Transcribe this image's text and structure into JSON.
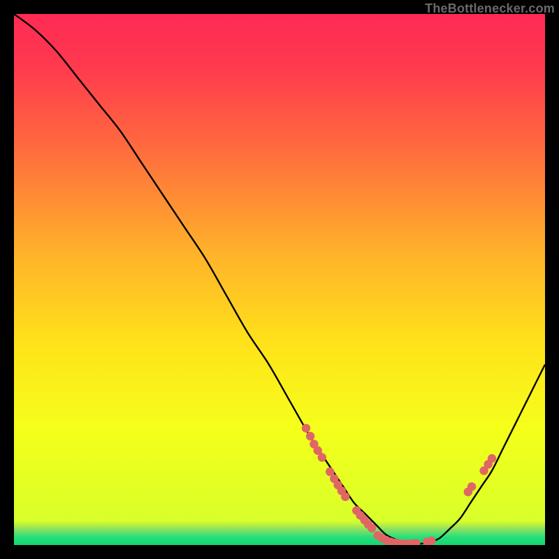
{
  "watermark": "TheBottlenecker.com",
  "chart_data": {
    "type": "line",
    "title": "",
    "xlabel": "",
    "ylabel": "",
    "xlim": [
      0,
      100
    ],
    "ylim": [
      0,
      100
    ],
    "background_gradient": {
      "stops": [
        {
          "offset": 0.0,
          "color": "#ff2a55"
        },
        {
          "offset": 0.1,
          "color": "#ff3a4e"
        },
        {
          "offset": 0.25,
          "color": "#ff6a3e"
        },
        {
          "offset": 0.45,
          "color": "#ffb22a"
        },
        {
          "offset": 0.62,
          "color": "#ffe21a"
        },
        {
          "offset": 0.78,
          "color": "#f5ff1a"
        },
        {
          "offset": 0.955,
          "color": "#d8ff2a"
        },
        {
          "offset": 0.97,
          "color": "#8de05f"
        },
        {
          "offset": 0.985,
          "color": "#27e07a"
        },
        {
          "offset": 1.0,
          "color": "#12d66e"
        }
      ]
    },
    "series": [
      {
        "name": "bottleneck-curve",
        "color": "#000000",
        "x": [
          0,
          4,
          8,
          12,
          16,
          20,
          24,
          28,
          32,
          36,
          40,
          44,
          48,
          52,
          56,
          58,
          60,
          62,
          64,
          66,
          68,
          70,
          72,
          74,
          76,
          78,
          80,
          82,
          84,
          86,
          88,
          90,
          92,
          94,
          96,
          98,
          100
        ],
        "y": [
          100,
          97,
          93,
          88,
          83,
          78,
          72,
          66,
          60,
          54,
          47,
          40,
          34,
          27,
          20,
          17,
          14,
          11,
          8,
          6,
          4,
          2,
          1,
          0.4,
          0.2,
          0.5,
          1.2,
          3,
          5,
          8,
          11,
          14,
          18,
          22,
          26,
          30,
          34
        ]
      }
    ],
    "markers": [
      {
        "name": "cluster-left-upper",
        "color": "#e06666",
        "points": [
          {
            "x": 55.0,
            "y": 22.0
          },
          {
            "x": 55.8,
            "y": 20.5
          },
          {
            "x": 56.5,
            "y": 19.0
          },
          {
            "x": 57.2,
            "y": 17.8
          },
          {
            "x": 58.0,
            "y": 16.5
          }
        ]
      },
      {
        "name": "cluster-left-mid",
        "color": "#e06666",
        "points": [
          {
            "x": 59.5,
            "y": 13.8
          },
          {
            "x": 60.3,
            "y": 12.5
          },
          {
            "x": 61.0,
            "y": 11.3
          },
          {
            "x": 61.7,
            "y": 10.2
          },
          {
            "x": 62.4,
            "y": 9.1
          }
        ]
      },
      {
        "name": "cluster-left-lower",
        "color": "#e06666",
        "points": [
          {
            "x": 64.5,
            "y": 6.5
          },
          {
            "x": 65.2,
            "y": 5.6
          },
          {
            "x": 66.0,
            "y": 4.7
          },
          {
            "x": 66.7,
            "y": 3.9
          },
          {
            "x": 67.4,
            "y": 3.2
          }
        ]
      },
      {
        "name": "cluster-bottom",
        "color": "#e06666",
        "points": [
          {
            "x": 68.5,
            "y": 1.8
          },
          {
            "x": 69.3,
            "y": 1.3
          },
          {
            "x": 70.1,
            "y": 0.9
          },
          {
            "x": 70.9,
            "y": 0.6
          },
          {
            "x": 71.7,
            "y": 0.4
          },
          {
            "x": 72.5,
            "y": 0.3
          },
          {
            "x": 73.3,
            "y": 0.2
          },
          {
            "x": 74.1,
            "y": 0.2
          },
          {
            "x": 74.9,
            "y": 0.25
          },
          {
            "x": 75.7,
            "y": 0.35
          },
          {
            "x": 77.8,
            "y": 0.6
          },
          {
            "x": 78.6,
            "y": 0.8
          }
        ]
      },
      {
        "name": "cluster-right-lower",
        "color": "#e06666",
        "points": [
          {
            "x": 85.5,
            "y": 10.0
          },
          {
            "x": 86.2,
            "y": 11.0
          }
        ]
      },
      {
        "name": "cluster-right-upper",
        "color": "#e06666",
        "points": [
          {
            "x": 88.5,
            "y": 14.0
          },
          {
            "x": 89.3,
            "y": 15.2
          },
          {
            "x": 90.0,
            "y": 16.3
          }
        ]
      }
    ]
  }
}
